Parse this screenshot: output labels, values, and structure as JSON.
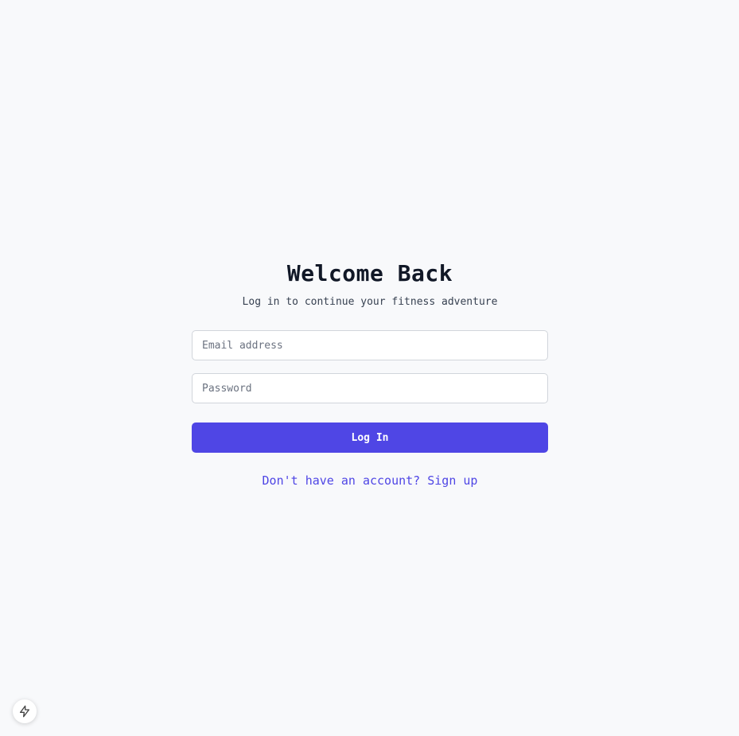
{
  "login": {
    "title": "Welcome Back",
    "subtitle": "Log in to continue your fitness adventure",
    "email_placeholder": "Email address",
    "email_value": "",
    "password_placeholder": "Password",
    "password_value": "",
    "submit_label": "Log In",
    "signup_link": "Don't have an account? Sign up"
  },
  "dev_badge": {
    "icon": "lightning-bolt-icon"
  },
  "colors": {
    "background": "#f8f9fb",
    "accent": "#4f46e5",
    "title": "#111827",
    "subtitle": "#374151"
  }
}
